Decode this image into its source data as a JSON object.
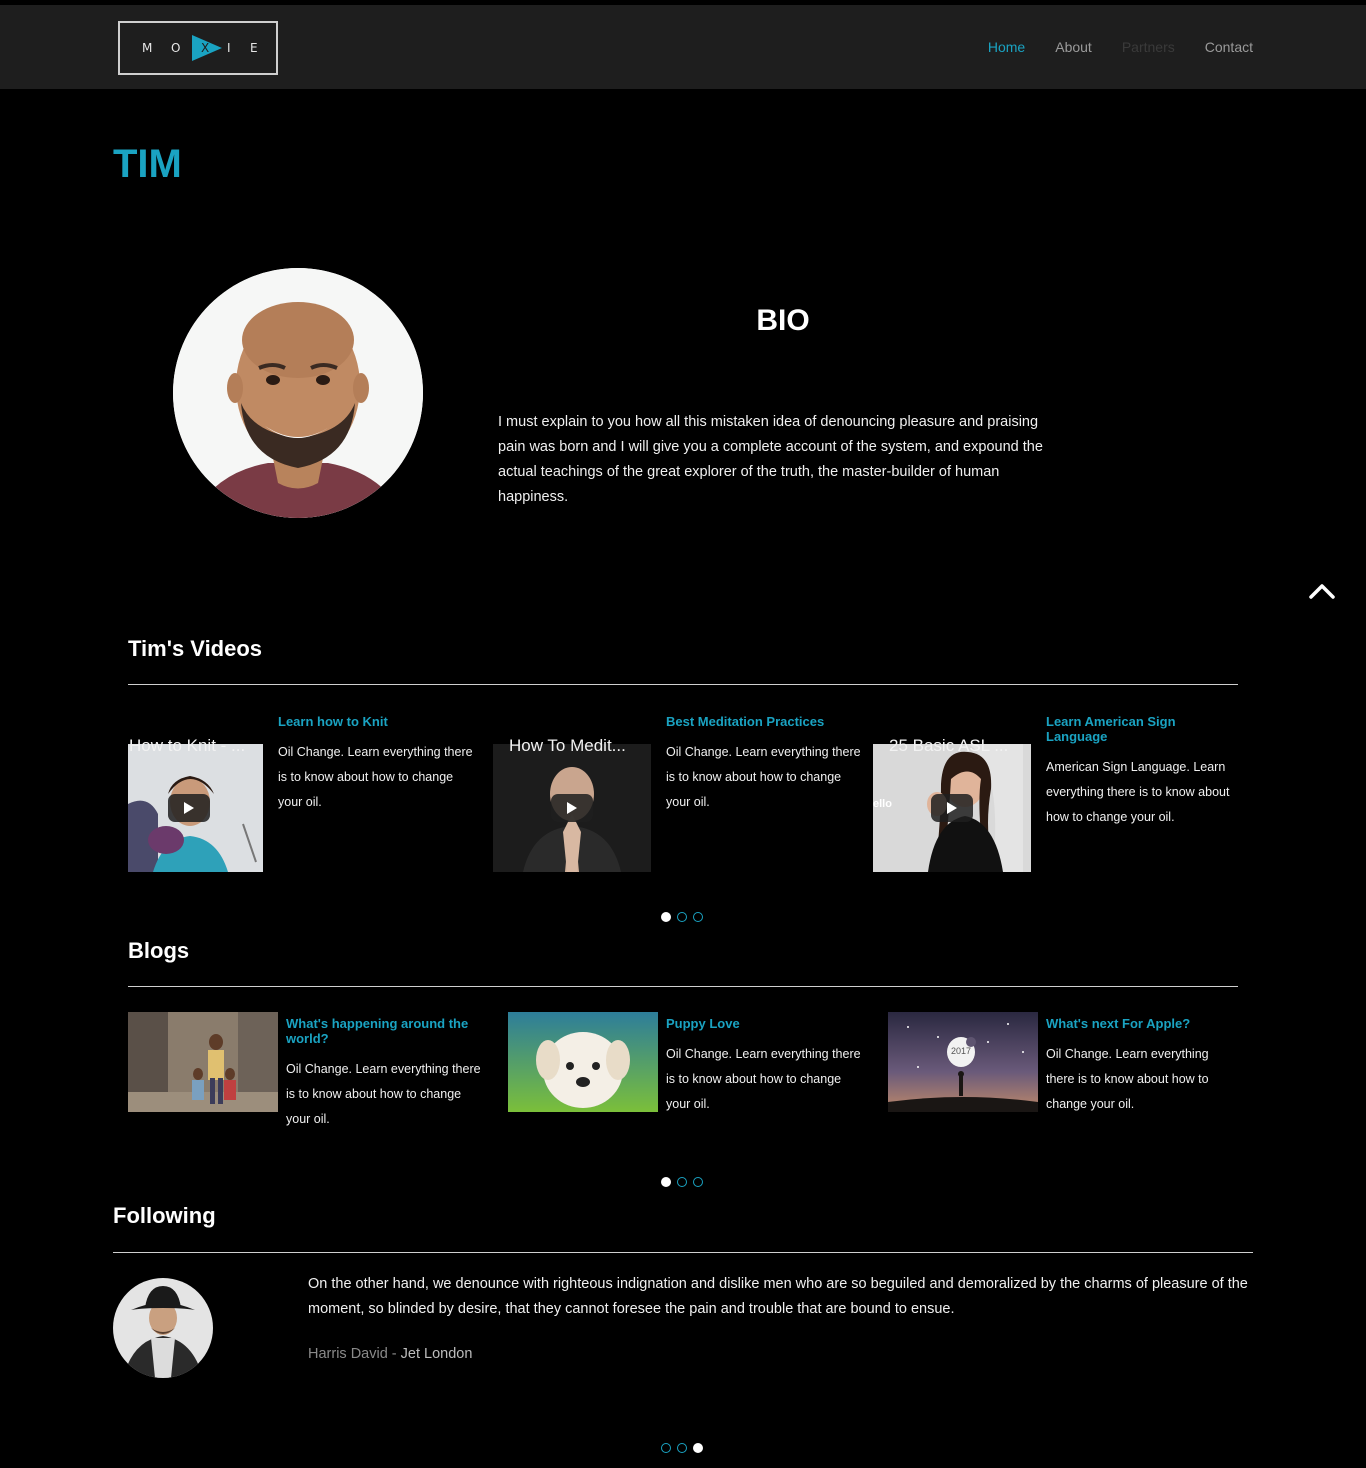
{
  "header": {
    "logo_letters": [
      "M",
      "O",
      "X",
      "I",
      "E"
    ],
    "nav": [
      {
        "label": "Home",
        "state": "active"
      },
      {
        "label": "About",
        "state": "normal"
      },
      {
        "label": "Partners",
        "state": "dim"
      },
      {
        "label": "Contact",
        "state": "normal"
      }
    ]
  },
  "profile": {
    "name": "TIM",
    "bio_heading": "BIO",
    "bio_text": "I must explain to you how all this mistaken idea of denouncing pleasure and praising pain was born and I will give you a complete account of the system, and expound the actual teachings of the great explorer of the truth, the master-builder of human happiness."
  },
  "videos": {
    "heading": "Tim's Videos",
    "items": [
      {
        "caption": "How to Knit - ...",
        "title": "Learn how to Knit",
        "text": "Oil Change. Learn everything there is to know about how to change your oil."
      },
      {
        "caption": "How To Medit...",
        "title": "Best Meditation Practices",
        "text": "Oil Change. Learn everything there is to know about how to change your oil."
      },
      {
        "caption": "25 Basic ASL ...",
        "title": "Learn American Sign Language",
        "text": "American Sign Language. Learn everything there is to know about how to change your oil.",
        "thumb_text": "ello"
      }
    ],
    "active_page": 1,
    "pages": 3
  },
  "blogs": {
    "heading": "Blogs",
    "items": [
      {
        "title": "What's happening around the world?",
        "text": "Oil Change. Learn everything there is to know about how to change your oil."
      },
      {
        "title": "Puppy Love",
        "text": "Oil Change. Learn everything there is to know about how to change your oil."
      },
      {
        "title": "What's next For Apple?",
        "text": "Oil Change. Learn everything there is to know about how to change your oil.",
        "thumb_text": "2017"
      }
    ],
    "active_page": 1,
    "pages": 3
  },
  "following": {
    "heading": "Following",
    "quote": "On the other hand, we denounce with righteous indignation and dislike men who are so beguiled and demoralized by the charms of pleasure of the moment, so blinded by desire, that they cannot foresee the pain and trouble that are bound to ensue.",
    "author": "Harris David",
    "separator": " - ",
    "company": "Jet London",
    "active_page": 3,
    "pages": 3
  },
  "colors": {
    "accent": "#1aa3c2",
    "navbar": "#1e1e1e",
    "background": "#000000"
  }
}
